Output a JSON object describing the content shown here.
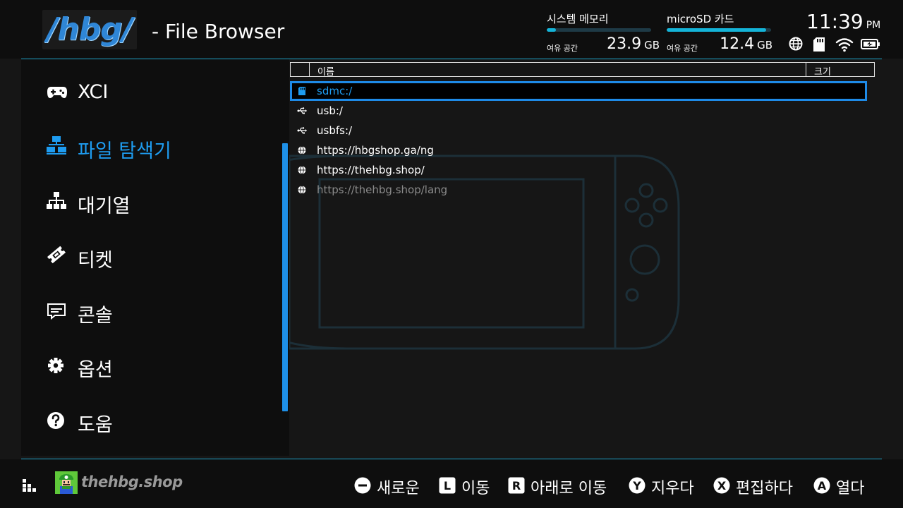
{
  "header": {
    "logo_text": "/hbg/",
    "app_title": "- File Browser",
    "memory": [
      {
        "name": "시스템 메모리",
        "free_label": "여유 공간",
        "value": "23.9",
        "unit": "GB",
        "usage_fraction": 0.09
      },
      {
        "name": "microSD 카드",
        "free_label": "여유 공간",
        "value": "12.4",
        "unit": "GB",
        "usage_fraction": 0.95
      }
    ],
    "clock": {
      "time": "11:39",
      "ampm": "PM"
    },
    "status_icons": [
      "globe-icon",
      "sd-card-icon",
      "wifi-icon",
      "battery-charging-icon"
    ]
  },
  "sidebar": {
    "items": [
      {
        "label": "XCI",
        "icon": "gamepad-icon",
        "active": false
      },
      {
        "label": "파일 탐색기",
        "icon": "file-tree-icon",
        "active": true
      },
      {
        "label": "대기열",
        "icon": "hierarchy-icon",
        "active": false
      },
      {
        "label": "티켓",
        "icon": "ticket-icon",
        "active": false
      },
      {
        "label": "콘솔",
        "icon": "console-icon",
        "active": false
      },
      {
        "label": "옵션",
        "icon": "gear-icon",
        "active": false
      },
      {
        "label": "도움",
        "icon": "help-icon",
        "active": false
      }
    ]
  },
  "table": {
    "columns": {
      "name": "이름",
      "size": "크기"
    },
    "rows": [
      {
        "icon": "sd-card-icon",
        "label": "sdmc:/",
        "selected": true
      },
      {
        "icon": "usb-icon",
        "label": "usb:/",
        "selected": false
      },
      {
        "icon": "usb-icon",
        "label": "usbfs:/",
        "selected": false
      },
      {
        "icon": "globe-icon",
        "label": "https://hbgshop.ga/ng",
        "selected": false
      },
      {
        "icon": "globe-icon",
        "label": "https://thehbg.shop/",
        "selected": false
      },
      {
        "icon": "globe-icon",
        "label": "https://thehbg.shop/lang",
        "selected": false,
        "dimmed": true
      }
    ]
  },
  "footer": {
    "user": {
      "name": "thehbg.shop"
    },
    "hints": [
      {
        "button": "−",
        "label": "새로운"
      },
      {
        "button": "L",
        "label": "이동"
      },
      {
        "button": "R",
        "label": "아래로 이동"
      },
      {
        "button": "Y",
        "label": "지우다"
      },
      {
        "button": "X",
        "label": "편집하다"
      },
      {
        "button": "A",
        "label": "열다"
      }
    ]
  },
  "colors": {
    "accent": "#1e9cf0",
    "divider": "#1ea3c9",
    "background": "#161616",
    "panel": "#0e0e0e"
  }
}
